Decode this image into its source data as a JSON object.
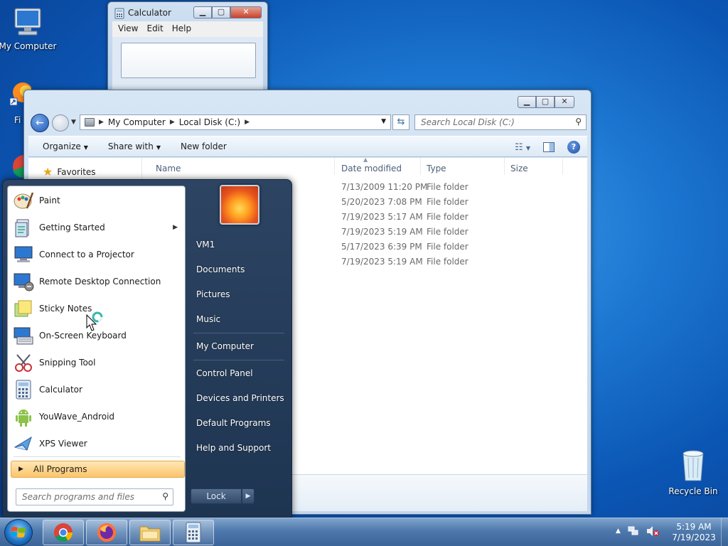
{
  "desktop": {
    "icons": [
      {
        "label": "My Computer"
      },
      {
        "label": "Recycle Bin"
      },
      {
        "label": "Fi"
      }
    ]
  },
  "calculator": {
    "title": "Calculator",
    "menu": [
      "View",
      "Edit",
      "Help"
    ]
  },
  "explorer": {
    "breadcrumb": [
      "My Computer",
      "Local Disk (C:)"
    ],
    "search_placeholder": "Search Local Disk (C:)",
    "toolbar": {
      "organize": "Organize",
      "share_with": "Share with",
      "new_folder": "New folder"
    },
    "nav": {
      "favorites": "Favorites"
    },
    "columns": {
      "name": "Name",
      "date_modified": "Date modified",
      "type": "Type",
      "size": "Size"
    },
    "rows": [
      {
        "date": "7/13/2009 11:20 PM",
        "type": "File folder"
      },
      {
        "date": "5/20/2023 7:08 PM",
        "type": "File folder"
      },
      {
        "date": "7/19/2023 5:17 AM",
        "type": "File folder"
      },
      {
        "date": "7/19/2023 5:19 AM",
        "type": "File folder"
      },
      {
        "date": "5/17/2023 6:39 PM",
        "type": "File folder"
      },
      {
        "date": "7/19/2023 5:19 AM",
        "type": "File folder"
      }
    ]
  },
  "start_menu": {
    "programs": [
      {
        "label": "Paint",
        "icon": "paint-icon"
      },
      {
        "label": "Getting Started",
        "icon": "getting-started-icon",
        "submenu": true
      },
      {
        "label": "Connect to a Projector",
        "icon": "projector-icon"
      },
      {
        "label": "Remote Desktop Connection",
        "icon": "remote-desktop-icon"
      },
      {
        "label": "Sticky Notes",
        "icon": "sticky-notes-icon"
      },
      {
        "label": "On-Screen Keyboard",
        "icon": "keyboard-icon"
      },
      {
        "label": "Snipping Tool",
        "icon": "snipping-tool-icon"
      },
      {
        "label": "Calculator",
        "icon": "calculator-icon"
      },
      {
        "label": "YouWave_Android",
        "icon": "android-icon"
      },
      {
        "label": "XPS Viewer",
        "icon": "xps-viewer-icon"
      }
    ],
    "all_programs": "All Programs",
    "search_placeholder": "Search programs and files",
    "right": {
      "user": "VM1",
      "documents": "Documents",
      "pictures": "Pictures",
      "music": "Music",
      "my_computer": "My Computer",
      "control_panel": "Control Panel",
      "devices_printers": "Devices and Printers",
      "default_programs": "Default Programs",
      "help_support": "Help and Support"
    },
    "lock": "Lock"
  },
  "taskbar": {
    "pinned": [
      "chrome-icon",
      "firefox-icon",
      "folder-icon",
      "calculator-icon"
    ],
    "clock_time": "5:19 AM",
    "clock_date": "7/19/2023"
  }
}
